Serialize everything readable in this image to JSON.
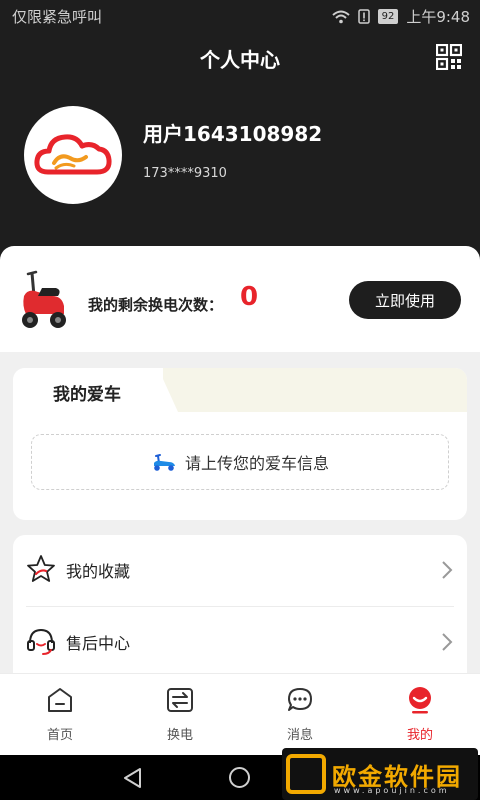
{
  "status_bar": {
    "carrier": "仅限紧急呼叫",
    "battery": "92",
    "time": "上午9:48"
  },
  "header": {
    "title": "个人中心"
  },
  "profile": {
    "username": "用户1643108982",
    "phone": "173****9310"
  },
  "swap": {
    "label": "我的剩余换电次数：",
    "count": "0",
    "button": "立即使用"
  },
  "car": {
    "title": "我的爱车",
    "upload_text": "请上传您的爱车信息"
  },
  "menu": [
    {
      "label": "我的收藏",
      "icon": "star-icon"
    },
    {
      "label": "售后中心",
      "icon": "headset-icon"
    }
  ],
  "tabs": [
    {
      "label": "首页",
      "icon": "home-icon",
      "active": false
    },
    {
      "label": "换电",
      "icon": "swap-icon",
      "active": false
    },
    {
      "label": "消息",
      "icon": "message-icon",
      "active": false
    },
    {
      "label": "我的",
      "icon": "profile-icon",
      "active": true
    }
  ],
  "watermark": {
    "text": "欧金软件园",
    "sub": "www.apoujin.com"
  },
  "colors": {
    "accent": "#e8242b",
    "dark": "#1e1e1e"
  }
}
